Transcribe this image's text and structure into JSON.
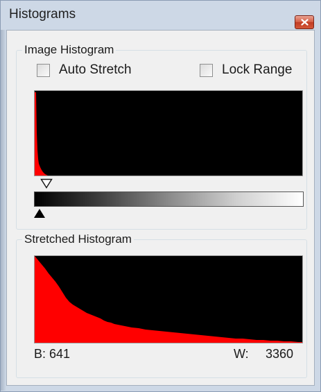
{
  "window": {
    "title": "Histograms"
  },
  "image_histogram": {
    "group_label": "Image Histogram",
    "auto_stretch_label": "Auto Stretch",
    "auto_stretch_checked": false,
    "lock_range_label": "Lock Range",
    "lock_range_checked": false,
    "histogram_color": "#ff0000",
    "white_marker_level": 0.06,
    "black_marker_level": 0.0
  },
  "stretched_histogram": {
    "group_label": "Stretched Histogram",
    "histogram_color": "#ff0000",
    "black_label": "B: 641",
    "white_label": "W:",
    "white_value": "3360"
  },
  "icons": {
    "close": "close-icon",
    "white_point_marker": "triangle-down-outline-icon",
    "black_point_marker": "triangle-up-filled-icon"
  }
}
